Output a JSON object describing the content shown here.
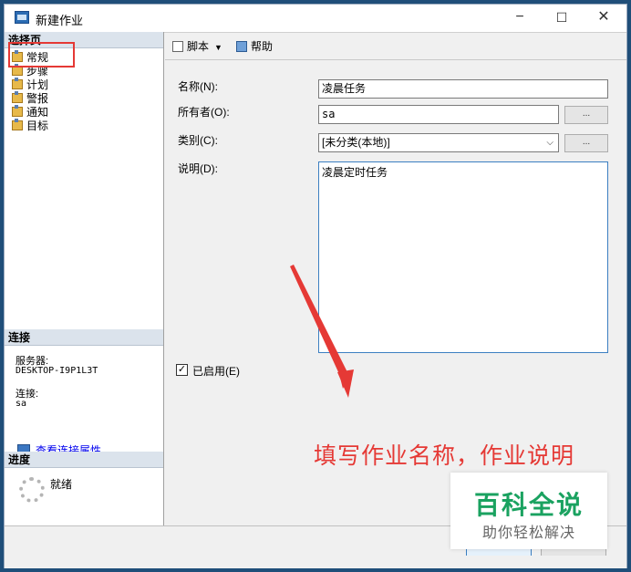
{
  "window": {
    "title": "新建作业",
    "controls": {
      "minimize": "−",
      "maximize": "☐",
      "close": "✕"
    }
  },
  "sidebar": {
    "select_page_header": "选择页",
    "pages": [
      {
        "label": "常规",
        "icon": "page-icon"
      },
      {
        "label": "步骤",
        "icon": "page-icon"
      },
      {
        "label": "计划",
        "icon": "page-icon"
      },
      {
        "label": "警报",
        "icon": "page-icon"
      },
      {
        "label": "通知",
        "icon": "page-icon"
      },
      {
        "label": "目标",
        "icon": "page-icon"
      }
    ],
    "connection_header": "连接",
    "server_label": "服务器:",
    "server_value": "DESKTOP-I9P1L3T",
    "connection_label": "连接:",
    "connection_value": "sa",
    "view_connection_link": "查看连接属性",
    "progress_header": "进度",
    "progress_status": "就绪"
  },
  "toolbar": {
    "script_label": "脚本",
    "help_label": "帮助"
  },
  "form": {
    "name_label": "名称(N):",
    "name_value": "凌晨任务",
    "owner_label": "所有者(O):",
    "owner_value": "sa",
    "category_label": "类别(C):",
    "category_value": "[未分类(本地)]",
    "description_label": "说明(D):",
    "description_value": "凌晨定时任务",
    "enabled_label": "已启用(E)",
    "enabled_checked": true,
    "browse_button": "..."
  },
  "annotation": {
    "text": "填写作业名称，作业说明",
    "color": "#e53935"
  },
  "watermark": {
    "main": "百科全说",
    "sub": "助你轻松解决",
    "color": "#1aa260"
  }
}
